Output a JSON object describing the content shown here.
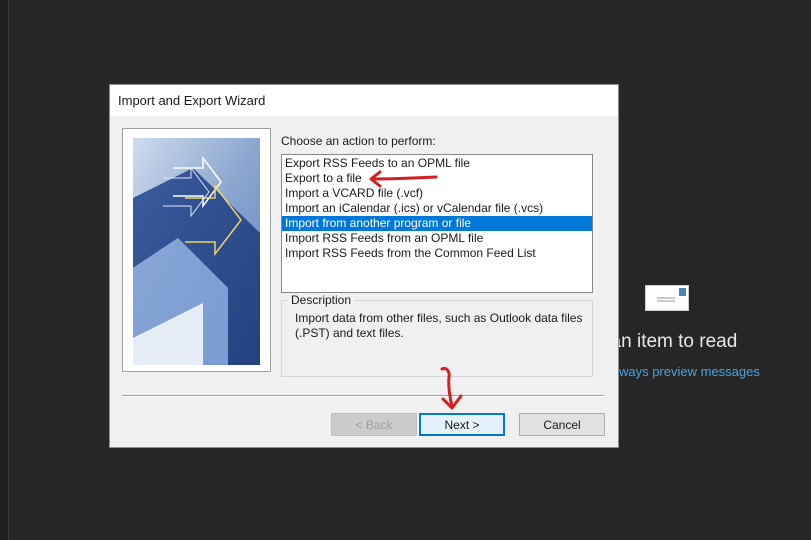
{
  "reading_pane": {
    "message": "t an item to read",
    "link": "o always preview messages",
    "envelope_icon": "envelope-icon"
  },
  "dialog": {
    "title": "Import and Export Wizard",
    "prompt": "Choose an action to perform:",
    "actions": [
      {
        "label": "Export RSS Feeds to an OPML file",
        "selected": false
      },
      {
        "label": "Export to a file",
        "selected": false
      },
      {
        "label": "Import a VCARD file (.vcf)",
        "selected": false
      },
      {
        "label": "Import an iCalendar (.ics) or vCalendar file (.vcs)",
        "selected": false
      },
      {
        "label": "Import from another program or file",
        "selected": true
      },
      {
        "label": "Import RSS Feeds from an OPML file",
        "selected": false
      },
      {
        "label": "Import RSS Feeds from the Common Feed List",
        "selected": false
      }
    ],
    "description_legend": "Description",
    "description_text": "Import data from other files, such as Outlook data files (.PST) and text files.",
    "buttons": {
      "back": "< Back",
      "next": "Next >",
      "cancel": "Cancel"
    }
  },
  "colors": {
    "selection": "#0078d7",
    "annotation": "#d21f1f",
    "link": "#4aa3e0"
  }
}
